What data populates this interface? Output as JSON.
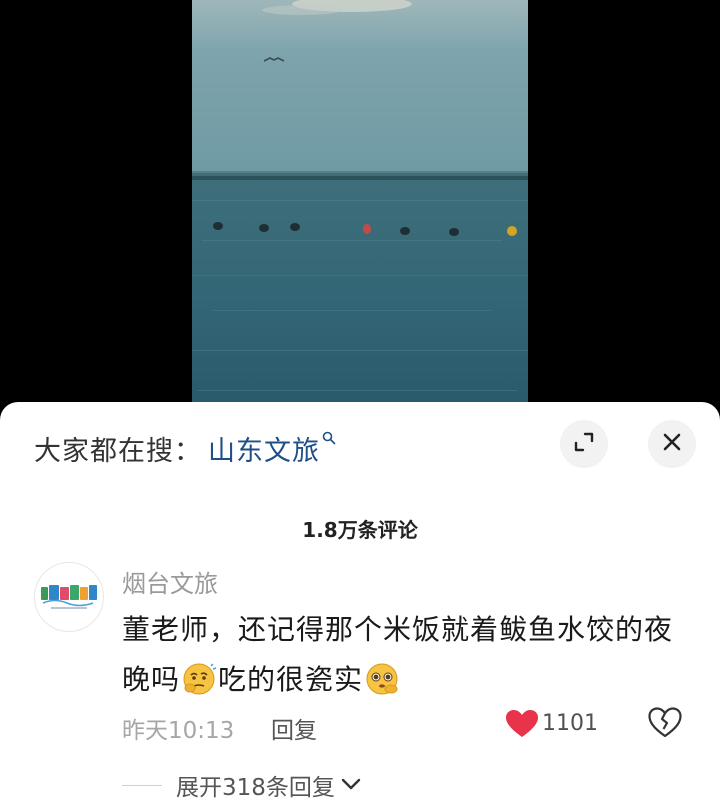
{
  "search_bar": {
    "prefix": "大家都在搜：",
    "term": "山东文旅"
  },
  "comments_header": {
    "count_label": "1.8万条评论"
  },
  "comment": {
    "username": "烟台文旅",
    "avatar_icon": "yantai-tourism-logo",
    "text_part1": "董老师，还记得那个米饭就着鲅鱼水饺的夜晚吗",
    "text_part2": "吃的很瓷实",
    "emoji_1": "thinking-face-emoji",
    "emoji_2": "pleading-face-emoji",
    "time": "昨天10:13",
    "reply_label": "回复",
    "like_count": "1101",
    "expand_replies_label": "展开318条回复"
  },
  "colors": {
    "search_term": "#1f4f88",
    "like_heart": "#e8334a",
    "sheet_background": "#ffffff"
  }
}
